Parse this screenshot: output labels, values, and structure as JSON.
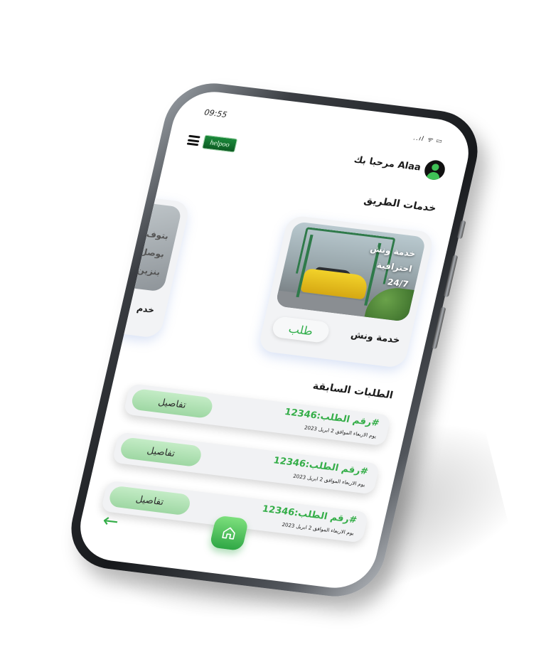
{
  "status_bar": {
    "time": "09:55",
    "icons": "..ıl ᯤ ▭"
  },
  "header": {
    "logo_text": "helpoo",
    "greeting": "مرحبا بك Alaa"
  },
  "road_services": {
    "title": "خدمات الطريق",
    "cards": [
      {
        "overlay_lines": [
          "خدمة ونش",
          "احترافية",
          "24/7"
        ],
        "name": "خدمة ونش",
        "request_label": "طلب"
      },
      {
        "overlay_lines": [
          "بتوف",
          "بوصل",
          "بنزين"
        ],
        "name": "خدم"
      }
    ]
  },
  "previous_orders": {
    "title": "الطلبات السابقة",
    "items": [
      {
        "number": "رقم الطلب:12346#",
        "date": "يوم الاربعاء الموافق 2 ابريل 2023",
        "details_label": "تفاصيل"
      },
      {
        "number": "رقم الطلب:12346#",
        "date": "يوم الاربعاء الموافق 2 ابريل 2023",
        "details_label": "تفاصيل"
      },
      {
        "number": "رقم الطلب:12346#",
        "date": "يوم الاربعاء الموافق 2 ابريل 2023",
        "details_label": "تفاصيل"
      }
    ]
  },
  "bottom_nav": {
    "back_icon": "arrow-left-icon",
    "back_glyph": "←",
    "home_icon": "home-icon"
  },
  "colors": {
    "accent_green": "#35ae49",
    "button_green_light": "#c4ecc6"
  }
}
